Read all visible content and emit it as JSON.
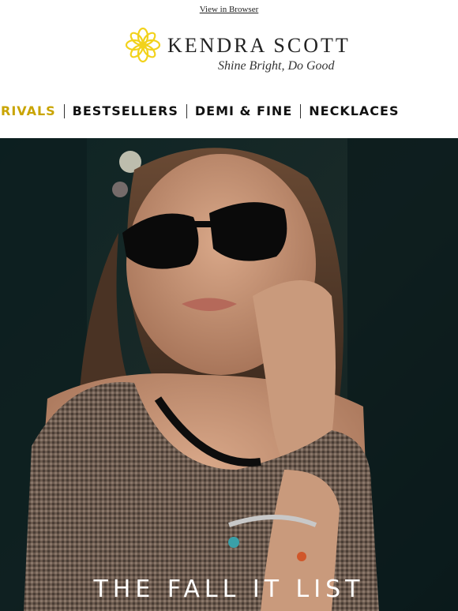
{
  "header": {
    "view_in_browser": "View in Browser",
    "brand_name": "KENDRA SCOTT",
    "tagline": "Shine Bright, Do Good",
    "logo_color": "#f2d21b"
  },
  "nav": {
    "items": [
      "RIVALS",
      "BESTSELLERS",
      "DEMI & FINE",
      "NECKLACES"
    ],
    "accent_color": "#c9a400"
  },
  "hero": {
    "title": "THE FALL IT LIST"
  }
}
